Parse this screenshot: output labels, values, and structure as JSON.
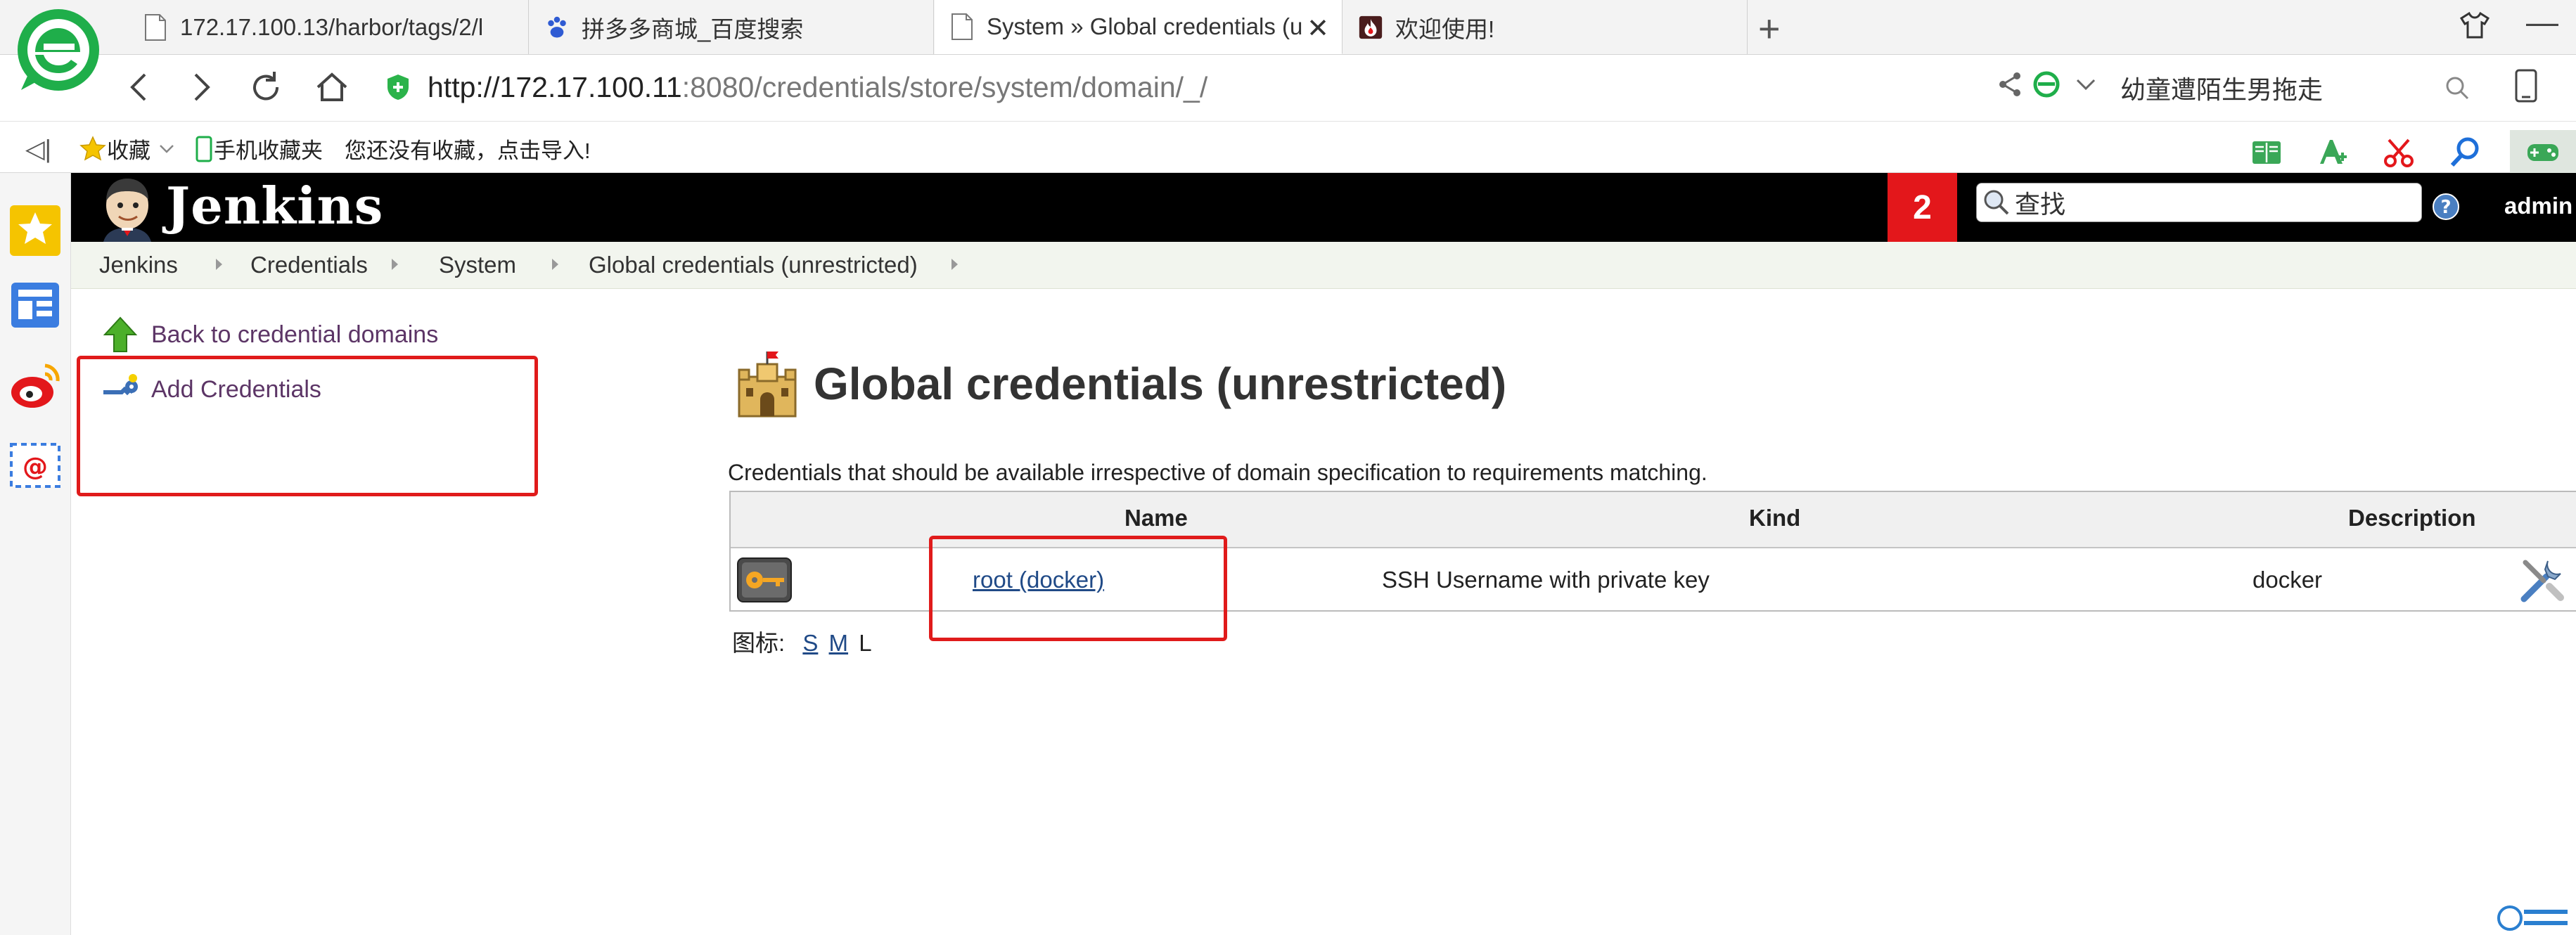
{
  "browser": {
    "tabs": [
      {
        "label": "172.17.100.13/harbor/tags/2/l",
        "icon": "page-icon",
        "active": false
      },
      {
        "label": "拼多多商城_百度搜索",
        "icon": "baidu-paw-icon",
        "active": false
      },
      {
        "label": "System » Global credentials (u",
        "icon": "page-icon",
        "active": true
      },
      {
        "label": "欢迎使用!",
        "icon": "fire-icon",
        "active": false
      }
    ],
    "url_host": "http://172.17.100.11",
    "url_rest": ":8080/credentials/store/system/domain/_/",
    "search_text": "幼童遭陌生男拖走",
    "bookmarks": {
      "favorites": "收藏",
      "mobile_favorites": "手机收藏夹",
      "import_hint": "您还没有收藏，点击导入!"
    },
    "colors": {
      "security_green": "#2bb34a",
      "ie_logo": "#1fae4a"
    }
  },
  "jenkins": {
    "brand": "Jenkins",
    "notification_count": "2",
    "search_placeholder": "查找",
    "user": "admin",
    "breadcrumb": [
      "Jenkins",
      "Credentials",
      "System",
      "Global credentials (unrestricted)"
    ],
    "side_tasks": {
      "back": "Back to credential domains",
      "add": "Add Credentials"
    },
    "title": "Global credentials (unrestricted)",
    "description": "Credentials that should be available irrespective of domain specification to requirements matching.",
    "table": {
      "headers": {
        "name": "Name",
        "kind": "Kind",
        "description": "Description"
      },
      "rows": [
        {
          "name": "root (docker)",
          "kind": "SSH Username with private key",
          "description": "docker"
        }
      ]
    },
    "icon_size": {
      "label": "图标:",
      "small": "S",
      "medium": "M",
      "large": "L"
    },
    "colors": {
      "header_bg": "#000000",
      "badge_red": "#e3171b",
      "link": "#204a87",
      "task_link": "#5c3566",
      "annotation_red": "#e01b1b"
    }
  }
}
